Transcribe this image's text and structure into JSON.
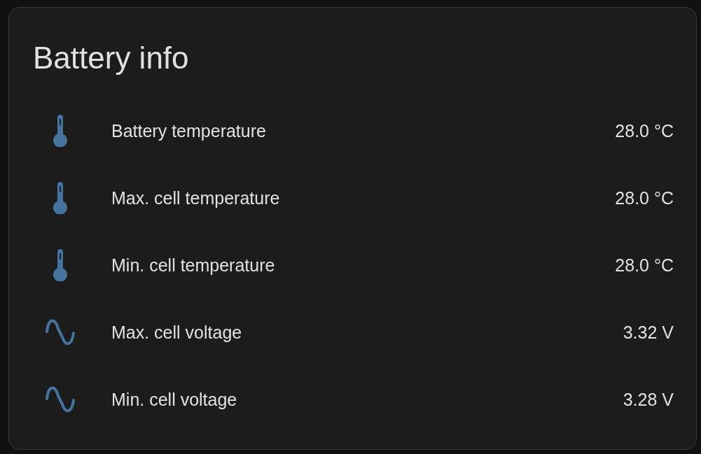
{
  "card": {
    "title": "Battery info",
    "rows": [
      {
        "kind": "temperature",
        "label": "Battery temperature",
        "value": "28.0 °C"
      },
      {
        "kind": "temperature",
        "label": "Max. cell temperature",
        "value": "28.0 °C"
      },
      {
        "kind": "temperature",
        "label": "Min. cell temperature",
        "value": "28.0 °C"
      },
      {
        "kind": "voltage",
        "label": "Max. cell voltage",
        "value": "3.32 V"
      },
      {
        "kind": "voltage",
        "label": "Min. cell voltage",
        "value": "3.28 V"
      }
    ]
  }
}
